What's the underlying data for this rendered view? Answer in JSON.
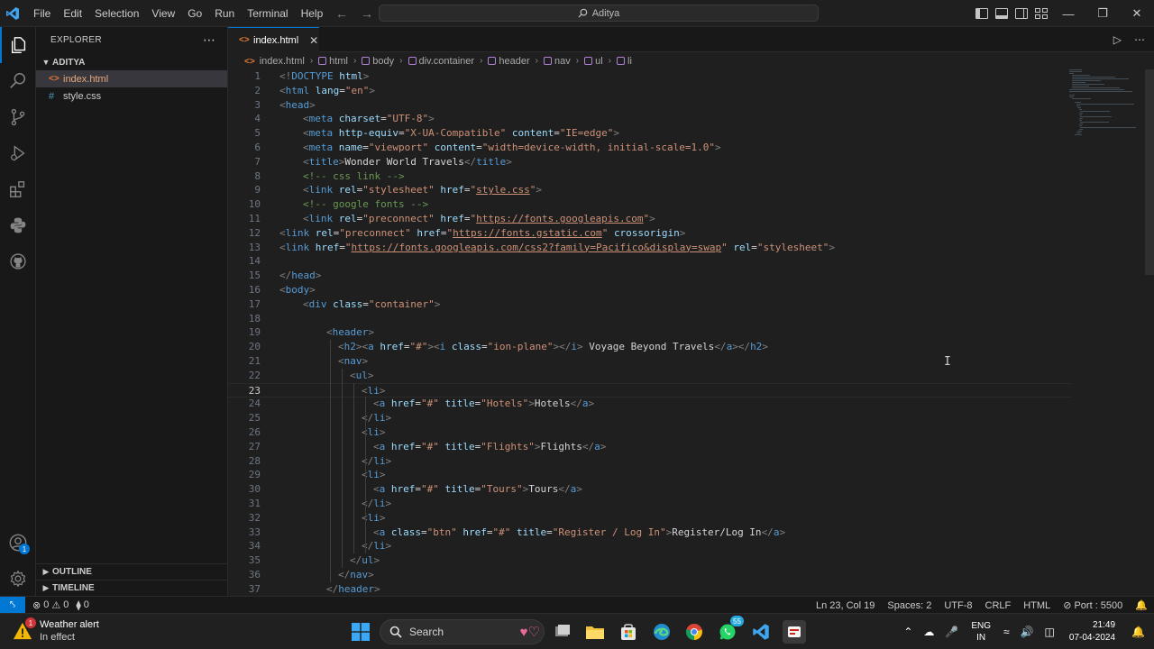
{
  "titlebar": {
    "menu": [
      "File",
      "Edit",
      "Selection",
      "View",
      "Go",
      "Run",
      "Terminal",
      "Help"
    ],
    "search_text": "Aditya"
  },
  "sidebar": {
    "header": "EXPLORER",
    "folder": "ADITYA",
    "files": [
      {
        "name": "index.html",
        "type": "html",
        "selected": true
      },
      {
        "name": "style.css",
        "type": "css",
        "selected": false
      }
    ],
    "outline_label": "OUTLINE",
    "timeline_label": "TIMELINE"
  },
  "accounts_badge": "1",
  "tab": {
    "label": "index.html"
  },
  "breadcrumb": [
    "index.html",
    "html",
    "body",
    "div.container",
    "header",
    "nav",
    "ul",
    "li"
  ],
  "editor": {
    "current_line": 23,
    "lines": [
      {
        "n": "1",
        "indent": 0,
        "segs": [
          [
            "p",
            "<!"
          ],
          [
            "t",
            "DOCTYPE"
          ],
          [
            "x",
            " "
          ],
          [
            "a",
            "html"
          ],
          [
            "p",
            ">"
          ]
        ]
      },
      {
        "n": "2",
        "indent": 0,
        "segs": [
          [
            "p",
            "<"
          ],
          [
            "t",
            "html"
          ],
          [
            "x",
            " "
          ],
          [
            "a",
            "lang"
          ],
          [
            "x",
            "="
          ],
          [
            "s",
            "\"en\""
          ],
          [
            "p",
            ">"
          ]
        ]
      },
      {
        "n": "3",
        "indent": 0,
        "segs": [
          [
            "p",
            "<"
          ],
          [
            "t",
            "head"
          ],
          [
            "p",
            ">"
          ]
        ]
      },
      {
        "n": "4",
        "indent": 1,
        "segs": [
          [
            "p",
            "<"
          ],
          [
            "t",
            "meta"
          ],
          [
            "x",
            " "
          ],
          [
            "a",
            "charset"
          ],
          [
            "x",
            "="
          ],
          [
            "s",
            "\"UTF-8\""
          ],
          [
            "p",
            ">"
          ]
        ]
      },
      {
        "n": "5",
        "indent": 1,
        "segs": [
          [
            "p",
            "<"
          ],
          [
            "t",
            "meta"
          ],
          [
            "x",
            " "
          ],
          [
            "a",
            "http-equiv"
          ],
          [
            "x",
            "="
          ],
          [
            "s",
            "\"X-UA-Compatible\""
          ],
          [
            "x",
            " "
          ],
          [
            "a",
            "content"
          ],
          [
            "x",
            "="
          ],
          [
            "s",
            "\"IE=edge\""
          ],
          [
            "p",
            ">"
          ]
        ]
      },
      {
        "n": "6",
        "indent": 1,
        "segs": [
          [
            "p",
            "<"
          ],
          [
            "t",
            "meta"
          ],
          [
            "x",
            " "
          ],
          [
            "a",
            "name"
          ],
          [
            "x",
            "="
          ],
          [
            "s",
            "\"viewport\""
          ],
          [
            "x",
            " "
          ],
          [
            "a",
            "content"
          ],
          [
            "x",
            "="
          ],
          [
            "s",
            "\"width=device-width, initial-scale=1.0\""
          ],
          [
            "p",
            ">"
          ]
        ]
      },
      {
        "n": "7",
        "indent": 1,
        "segs": [
          [
            "p",
            "<"
          ],
          [
            "t",
            "title"
          ],
          [
            "p",
            ">"
          ],
          [
            "x",
            "Wonder World Travels"
          ],
          [
            "p",
            "</"
          ],
          [
            "t",
            "title"
          ],
          [
            "p",
            ">"
          ]
        ]
      },
      {
        "n": "8",
        "indent": 1,
        "segs": [
          [
            "c",
            "<!-- css link -->"
          ]
        ]
      },
      {
        "n": "9",
        "indent": 1,
        "segs": [
          [
            "p",
            "<"
          ],
          [
            "t",
            "link"
          ],
          [
            "x",
            " "
          ],
          [
            "a",
            "rel"
          ],
          [
            "x",
            "="
          ],
          [
            "s",
            "\"stylesheet\""
          ],
          [
            "x",
            " "
          ],
          [
            "a",
            "href"
          ],
          [
            "x",
            "="
          ],
          [
            "s",
            "\""
          ],
          [
            "su",
            "style.css"
          ],
          [
            "s",
            "\""
          ],
          [
            "p",
            ">"
          ]
        ]
      },
      {
        "n": "10",
        "indent": 1,
        "segs": [
          [
            "c",
            "<!-- google fonts -->"
          ]
        ]
      },
      {
        "n": "11",
        "indent": 1,
        "segs": [
          [
            "p",
            "<"
          ],
          [
            "t",
            "link"
          ],
          [
            "x",
            " "
          ],
          [
            "a",
            "rel"
          ],
          [
            "x",
            "="
          ],
          [
            "s",
            "\"preconnect\""
          ],
          [
            "x",
            " "
          ],
          [
            "a",
            "href"
          ],
          [
            "x",
            "="
          ],
          [
            "s",
            "\""
          ],
          [
            "su",
            "https://fonts.googleapis.com"
          ],
          [
            "s",
            "\""
          ],
          [
            "p",
            ">"
          ]
        ]
      },
      {
        "n": "12",
        "indent": 0,
        "segs": [
          [
            "p",
            "<"
          ],
          [
            "t",
            "link"
          ],
          [
            "x",
            " "
          ],
          [
            "a",
            "rel"
          ],
          [
            "x",
            "="
          ],
          [
            "s",
            "\"preconnect\""
          ],
          [
            "x",
            " "
          ],
          [
            "a",
            "href"
          ],
          [
            "x",
            "="
          ],
          [
            "s",
            "\""
          ],
          [
            "su",
            "https://fonts.gstatic.com"
          ],
          [
            "s",
            "\""
          ],
          [
            "x",
            " "
          ],
          [
            "a",
            "crossorigin"
          ],
          [
            "p",
            ">"
          ]
        ]
      },
      {
        "n": "13",
        "indent": 0,
        "segs": [
          [
            "p",
            "<"
          ],
          [
            "t",
            "link"
          ],
          [
            "x",
            " "
          ],
          [
            "a",
            "href"
          ],
          [
            "x",
            "="
          ],
          [
            "s",
            "\""
          ],
          [
            "su",
            "https://fonts.googleapis.com/css2?family=Pacifico&display=swap"
          ],
          [
            "s",
            "\""
          ],
          [
            "x",
            " "
          ],
          [
            "a",
            "rel"
          ],
          [
            "x",
            "="
          ],
          [
            "s",
            "\"stylesheet\""
          ],
          [
            "p",
            ">"
          ]
        ]
      },
      {
        "n": "14",
        "indent": 0,
        "segs": []
      },
      {
        "n": "15",
        "indent": 0,
        "segs": [
          [
            "p",
            "</"
          ],
          [
            "t",
            "head"
          ],
          [
            "p",
            ">"
          ]
        ]
      },
      {
        "n": "16",
        "indent": 0,
        "segs": [
          [
            "p",
            "<"
          ],
          [
            "t",
            "body"
          ],
          [
            "p",
            ">"
          ]
        ]
      },
      {
        "n": "17",
        "indent": 1,
        "segs": [
          [
            "p",
            "<"
          ],
          [
            "t",
            "div"
          ],
          [
            "x",
            " "
          ],
          [
            "a",
            "class"
          ],
          [
            "x",
            "="
          ],
          [
            "s",
            "\"container\""
          ],
          [
            "p",
            ">"
          ]
        ]
      },
      {
        "n": "18",
        "indent": 0,
        "segs": []
      },
      {
        "n": "19",
        "indent": 2,
        "segs": [
          [
            "p",
            "<"
          ],
          [
            "t",
            "header"
          ],
          [
            "p",
            ">"
          ]
        ]
      },
      {
        "n": "20",
        "indent": 2.5,
        "segs": [
          [
            "p",
            "<"
          ],
          [
            "t",
            "h2"
          ],
          [
            "p",
            "><"
          ],
          [
            "t",
            "a"
          ],
          [
            "x",
            " "
          ],
          [
            "a",
            "href"
          ],
          [
            "x",
            "="
          ],
          [
            "s",
            "\"#\""
          ],
          [
            "p",
            "><"
          ],
          [
            "t",
            "i"
          ],
          [
            "x",
            " "
          ],
          [
            "a",
            "class"
          ],
          [
            "x",
            "="
          ],
          [
            "s",
            "\"ion-plane\""
          ],
          [
            "p",
            "></"
          ],
          [
            "t",
            "i"
          ],
          [
            "p",
            ">"
          ],
          [
            "x",
            " Voyage Beyond Travels"
          ],
          [
            "p",
            "</"
          ],
          [
            "t",
            "a"
          ],
          [
            "p",
            "></"
          ],
          [
            "t",
            "h2"
          ],
          [
            "p",
            ">"
          ]
        ]
      },
      {
        "n": "21",
        "indent": 2.5,
        "segs": [
          [
            "p",
            "<"
          ],
          [
            "t",
            "nav"
          ],
          [
            "p",
            ">"
          ]
        ]
      },
      {
        "n": "22",
        "indent": 3,
        "segs": [
          [
            "p",
            "<"
          ],
          [
            "t",
            "ul"
          ],
          [
            "p",
            ">"
          ]
        ]
      },
      {
        "n": "23",
        "indent": 3.5,
        "segs": [
          [
            "p",
            "<"
          ],
          [
            "t",
            "li"
          ],
          [
            "p",
            ">"
          ]
        ]
      },
      {
        "n": "24",
        "indent": 4,
        "segs": [
          [
            "p",
            "<"
          ],
          [
            "t",
            "a"
          ],
          [
            "x",
            " "
          ],
          [
            "a",
            "href"
          ],
          [
            "x",
            "="
          ],
          [
            "s",
            "\"#\""
          ],
          [
            "x",
            " "
          ],
          [
            "a",
            "title"
          ],
          [
            "x",
            "="
          ],
          [
            "s",
            "\"Hotels\""
          ],
          [
            "p",
            ">"
          ],
          [
            "x",
            "Hotels"
          ],
          [
            "p",
            "</"
          ],
          [
            "t",
            "a"
          ],
          [
            "p",
            ">"
          ]
        ]
      },
      {
        "n": "25",
        "indent": 3.5,
        "segs": [
          [
            "p",
            "</"
          ],
          [
            "t",
            "li"
          ],
          [
            "p",
            ">"
          ]
        ]
      },
      {
        "n": "26",
        "indent": 3.5,
        "segs": [
          [
            "p",
            "<"
          ],
          [
            "t",
            "li"
          ],
          [
            "p",
            ">"
          ]
        ]
      },
      {
        "n": "27",
        "indent": 4,
        "segs": [
          [
            "p",
            "<"
          ],
          [
            "t",
            "a"
          ],
          [
            "x",
            " "
          ],
          [
            "a",
            "href"
          ],
          [
            "x",
            "="
          ],
          [
            "s",
            "\"#\""
          ],
          [
            "x",
            " "
          ],
          [
            "a",
            "title"
          ],
          [
            "x",
            "="
          ],
          [
            "s",
            "\"Flights\""
          ],
          [
            "p",
            ">"
          ],
          [
            "x",
            "Flights"
          ],
          [
            "p",
            "</"
          ],
          [
            "t",
            "a"
          ],
          [
            "p",
            ">"
          ]
        ]
      },
      {
        "n": "28",
        "indent": 3.5,
        "segs": [
          [
            "p",
            "</"
          ],
          [
            "t",
            "li"
          ],
          [
            "p",
            ">"
          ]
        ]
      },
      {
        "n": "29",
        "indent": 3.5,
        "segs": [
          [
            "p",
            "<"
          ],
          [
            "t",
            "li"
          ],
          [
            "p",
            ">"
          ]
        ]
      },
      {
        "n": "30",
        "indent": 4,
        "segs": [
          [
            "p",
            "<"
          ],
          [
            "t",
            "a"
          ],
          [
            "x",
            " "
          ],
          [
            "a",
            "href"
          ],
          [
            "x",
            "="
          ],
          [
            "s",
            "\"#\""
          ],
          [
            "x",
            " "
          ],
          [
            "a",
            "title"
          ],
          [
            "x",
            "="
          ],
          [
            "s",
            "\"Tours\""
          ],
          [
            "p",
            ">"
          ],
          [
            "x",
            "Tours"
          ],
          [
            "p",
            "</"
          ],
          [
            "t",
            "a"
          ],
          [
            "p",
            ">"
          ]
        ]
      },
      {
        "n": "31",
        "indent": 3.5,
        "segs": [
          [
            "p",
            "</"
          ],
          [
            "t",
            "li"
          ],
          [
            "p",
            ">"
          ]
        ]
      },
      {
        "n": "32",
        "indent": 3.5,
        "segs": [
          [
            "p",
            "<"
          ],
          [
            "t",
            "li"
          ],
          [
            "p",
            ">"
          ]
        ]
      },
      {
        "n": "33",
        "indent": 4,
        "segs": [
          [
            "p",
            "<"
          ],
          [
            "t",
            "a"
          ],
          [
            "x",
            " "
          ],
          [
            "a",
            "class"
          ],
          [
            "x",
            "="
          ],
          [
            "s",
            "\"btn\""
          ],
          [
            "x",
            " "
          ],
          [
            "a",
            "href"
          ],
          [
            "x",
            "="
          ],
          [
            "s",
            "\"#\""
          ],
          [
            "x",
            " "
          ],
          [
            "a",
            "title"
          ],
          [
            "x",
            "="
          ],
          [
            "s",
            "\"Register / Log In\""
          ],
          [
            "p",
            ">"
          ],
          [
            "x",
            "Register/Log In"
          ],
          [
            "p",
            "</"
          ],
          [
            "t",
            "a"
          ],
          [
            "p",
            ">"
          ]
        ]
      },
      {
        "n": "34",
        "indent": 3.5,
        "segs": [
          [
            "p",
            "</"
          ],
          [
            "t",
            "li"
          ],
          [
            "p",
            ">"
          ]
        ]
      },
      {
        "n": "35",
        "indent": 3,
        "segs": [
          [
            "p",
            "</"
          ],
          [
            "t",
            "ul"
          ],
          [
            "p",
            ">"
          ]
        ]
      },
      {
        "n": "36",
        "indent": 2.5,
        "segs": [
          [
            "p",
            "</"
          ],
          [
            "t",
            "nav"
          ],
          [
            "p",
            ">"
          ]
        ]
      },
      {
        "n": "37",
        "indent": 2,
        "segs": [
          [
            "p",
            "</"
          ],
          [
            "t",
            "header"
          ],
          [
            "p",
            ">"
          ]
        ]
      }
    ]
  },
  "statusbar": {
    "errors": "0",
    "warnings": "0",
    "ports": "0",
    "position": "Ln 23, Col 19",
    "spaces": "Spaces: 2",
    "encoding": "UTF-8",
    "eol": "CRLF",
    "language": "HTML",
    "port": "Port : 5500"
  },
  "taskbar": {
    "weather_title": "Weather alert",
    "weather_sub": "In effect",
    "weather_badge": "1",
    "search_label": "Search",
    "whatsapp_badge": "55",
    "lang_top": "ENG",
    "lang_bottom": "IN",
    "time": "21:49",
    "date": "07-04-2024"
  },
  "colors": {
    "accent": "#0078d4",
    "tag": "#569cd6",
    "attribute": "#9cdcfe",
    "string": "#ce9178",
    "comment": "#6a9955"
  }
}
